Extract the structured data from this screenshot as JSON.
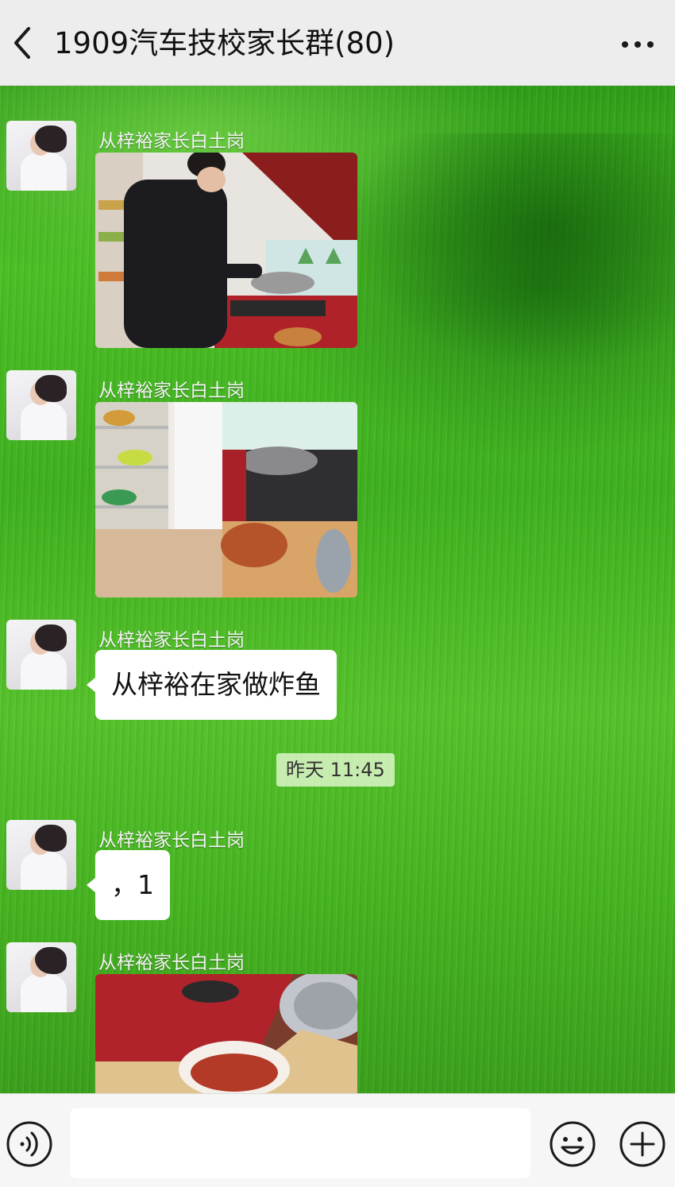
{
  "header": {
    "title": "1909汽车技校家长群(80)"
  },
  "messages": [
    {
      "sender": "从梓裕家长白土岗",
      "type": "image",
      "image_description": "boy-cooking-at-stove"
    },
    {
      "sender": "从梓裕家长白土岗",
      "type": "image",
      "image_description": "kitchen-with-fried-fish"
    },
    {
      "sender": "从梓裕家长白土岗",
      "type": "text",
      "text": "从梓裕在家做炸鱼"
    },
    {
      "sender": "从梓裕家长白土岗",
      "type": "text",
      "text": "，1"
    },
    {
      "sender": "从梓裕家长白土岗",
      "type": "image",
      "image_description": "plate-of-fried-fish-near-stove"
    }
  ],
  "timestamp": "昨天 11:45",
  "input": {
    "value": ""
  },
  "icons": {
    "back": "chevron-left-icon",
    "more": "more-dots-icon",
    "voice": "voice-icon",
    "emoji": "emoji-icon",
    "plus": "plus-icon"
  },
  "colors": {
    "header_bg": "#ededed",
    "bubble_bg": "#ffffff",
    "chat_bg": "#3fae1f"
  }
}
